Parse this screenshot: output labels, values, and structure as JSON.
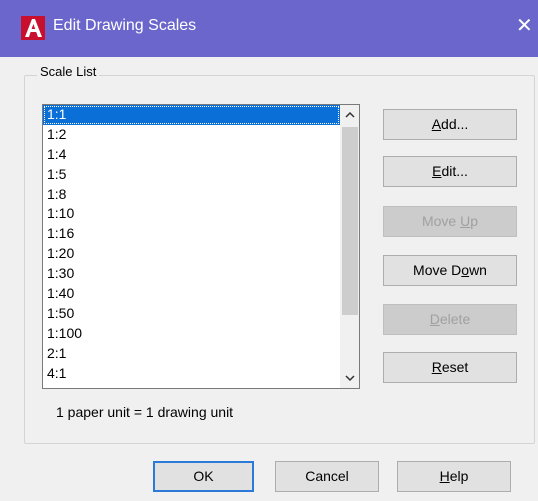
{
  "window": {
    "title": "Edit Drawing Scales",
    "close_glyph": "✕",
    "app_icon": "autocad-a-icon",
    "titlebar_color": "#6b66cc"
  },
  "group": {
    "legend": "Scale List"
  },
  "scale_list": {
    "items": [
      "1:1",
      "1:2",
      "1:4",
      "1:5",
      "1:8",
      "1:10",
      "1:16",
      "1:20",
      "1:30",
      "1:40",
      "1:50",
      "1:100",
      "2:1",
      "4:1"
    ],
    "selected": "1:1"
  },
  "side_buttons": {
    "add": {
      "before": "",
      "ul": "A",
      "after": "dd..."
    },
    "edit": {
      "before": "",
      "ul": "E",
      "after": "dit..."
    },
    "move_up": {
      "before": "Move ",
      "ul": "U",
      "after": "p"
    },
    "move_down": {
      "before": "Move D",
      "ul": "o",
      "after": "wn"
    },
    "delete": {
      "before": "",
      "ul": "D",
      "after": "elete"
    },
    "reset": {
      "before": "",
      "ul": "R",
      "after": "eset"
    }
  },
  "status_text": "1 paper unit = 1 drawing unit",
  "footer": {
    "ok": "OK",
    "cancel": "Cancel",
    "help": {
      "before": "",
      "ul": "H",
      "after": "elp"
    }
  },
  "colors": {
    "selection": "#0a6fd6",
    "default_button_border": "#2b7ad8"
  }
}
